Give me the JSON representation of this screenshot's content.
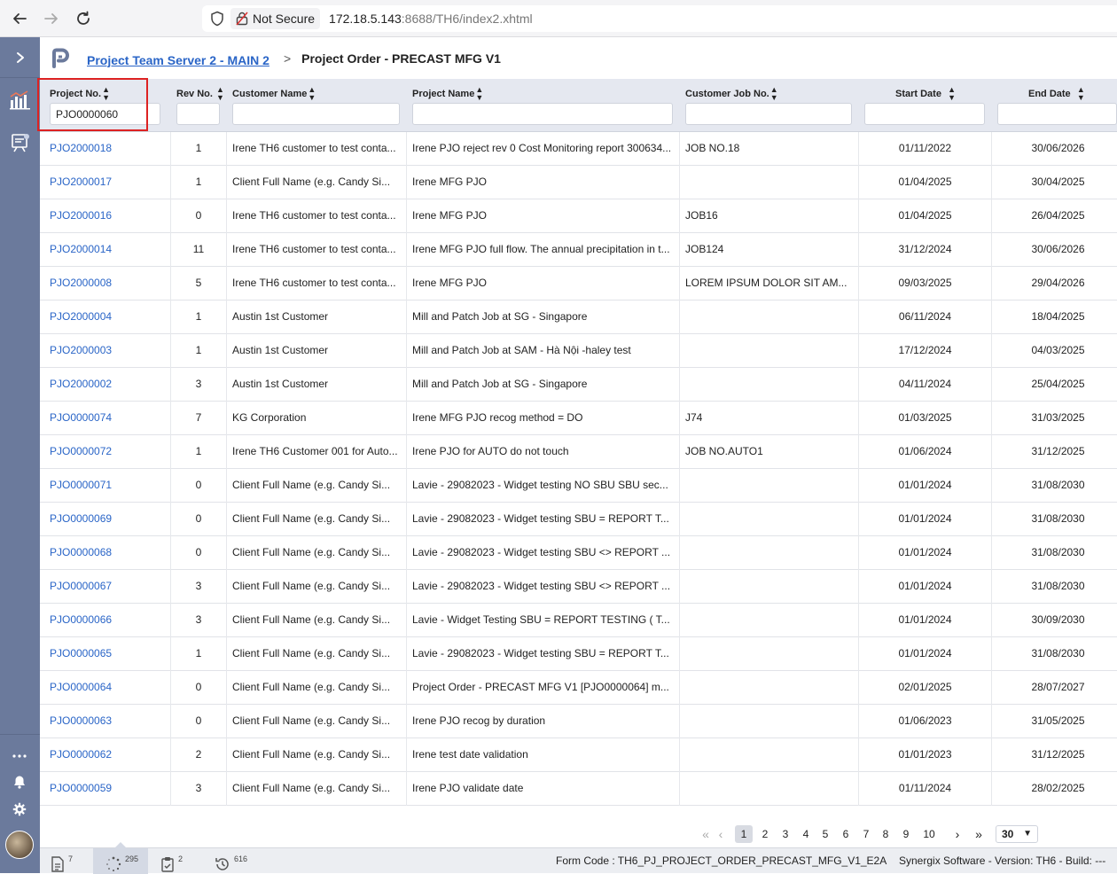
{
  "browser": {
    "security_label": "Not Secure",
    "url_host": "172.18.5.143",
    "url_rest": ":8688/TH6/index2.xhtml"
  },
  "breadcrumb": {
    "parent": "Project Team Server 2 - MAIN 2",
    "separator": ">",
    "current": "Project Order - PRECAST MFG V1"
  },
  "columns": [
    {
      "key": "project_no",
      "label": "Project No."
    },
    {
      "key": "rev_no",
      "label": "Rev No."
    },
    {
      "key": "customer_name",
      "label": "Customer Name"
    },
    {
      "key": "project_name",
      "label": "Project Name"
    },
    {
      "key": "customer_job_no",
      "label": "Customer Job No."
    },
    {
      "key": "start_date",
      "label": "Start Date"
    },
    {
      "key": "end_date",
      "label": "End Date"
    }
  ],
  "filters": {
    "project_no": "PJO0000060",
    "rev_no": "",
    "customer_name": "",
    "project_name": "",
    "customer_job_no": "",
    "start_date": "",
    "end_date": ""
  },
  "rows": [
    {
      "project_no": "PJO2000018",
      "rev_no": "1",
      "customer_name": "Irene TH6 customer to test conta...",
      "project_name": "Irene PJO reject rev 0 Cost Monitoring report 300634...",
      "customer_job_no": "JOB NO.18",
      "start_date": "01/11/2022",
      "end_date": "30/06/2026"
    },
    {
      "project_no": "PJO2000017",
      "rev_no": "1",
      "customer_name": "Client Full Name (e.g. Candy Si...",
      "project_name": "Irene MFG PJO",
      "customer_job_no": "",
      "start_date": "01/04/2025",
      "end_date": "30/04/2025"
    },
    {
      "project_no": "PJO2000016",
      "rev_no": "0",
      "customer_name": "Irene TH6 customer to test conta...",
      "project_name": "Irene MFG PJO",
      "customer_job_no": "JOB16",
      "start_date": "01/04/2025",
      "end_date": "26/04/2025"
    },
    {
      "project_no": "PJO2000014",
      "rev_no": "11",
      "customer_name": "Irene TH6 customer to test conta...",
      "project_name": "Irene MFG PJO full flow. The annual precipitation in t...",
      "customer_job_no": "JOB124",
      "start_date": "31/12/2024",
      "end_date": "30/06/2026"
    },
    {
      "project_no": "PJO2000008",
      "rev_no": "5",
      "customer_name": "Irene TH6 customer to test conta...",
      "project_name": "Irene MFG PJO",
      "customer_job_no": "LOREM IPSUM DOLOR SIT AM...",
      "start_date": "09/03/2025",
      "end_date": "29/04/2026"
    },
    {
      "project_no": "PJO2000004",
      "rev_no": "1",
      "customer_name": "Austin 1st Customer",
      "project_name": "Mill and Patch Job at SG - Singapore",
      "customer_job_no": "",
      "start_date": "06/11/2024",
      "end_date": "18/04/2025"
    },
    {
      "project_no": "PJO2000003",
      "rev_no": "1",
      "customer_name": "Austin 1st Customer",
      "project_name": "Mill and Patch Job at SAM - Hà Nội -haley test",
      "customer_job_no": "",
      "start_date": "17/12/2024",
      "end_date": "04/03/2025"
    },
    {
      "project_no": "PJO2000002",
      "rev_no": "3",
      "customer_name": "Austin 1st Customer",
      "project_name": "Mill and Patch Job at SG - Singapore",
      "customer_job_no": "",
      "start_date": "04/11/2024",
      "end_date": "25/04/2025"
    },
    {
      "project_no": "PJO0000074",
      "rev_no": "7",
      "customer_name": "KG Corporation",
      "project_name": "Irene MFG PJO recog method = DO",
      "customer_job_no": "J74",
      "start_date": "01/03/2025",
      "end_date": "31/03/2025"
    },
    {
      "project_no": "PJO0000072",
      "rev_no": "1",
      "customer_name": "Irene TH6 Customer 001 for Auto...",
      "project_name": "Irene PJO for AUTO do not touch",
      "customer_job_no": "JOB NO.AUTO1",
      "start_date": "01/06/2024",
      "end_date": "31/12/2025"
    },
    {
      "project_no": "PJO0000071",
      "rev_no": "0",
      "customer_name": "Client Full Name (e.g. Candy Si...",
      "project_name": "Lavie - 29082023 - Widget testing NO SBU SBU sec...",
      "customer_job_no": "",
      "start_date": "01/01/2024",
      "end_date": "31/08/2030"
    },
    {
      "project_no": "PJO0000069",
      "rev_no": "0",
      "customer_name": "Client Full Name (e.g. Candy Si...",
      "project_name": "Lavie - 29082023 - Widget testing SBU = REPORT T...",
      "customer_job_no": "",
      "start_date": "01/01/2024",
      "end_date": "31/08/2030"
    },
    {
      "project_no": "PJO0000068",
      "rev_no": "0",
      "customer_name": "Client Full Name (e.g. Candy Si...",
      "project_name": "Lavie - 29082023 - Widget testing SBU <> REPORT ...",
      "customer_job_no": "",
      "start_date": "01/01/2024",
      "end_date": "31/08/2030"
    },
    {
      "project_no": "PJO0000067",
      "rev_no": "3",
      "customer_name": "Client Full Name (e.g. Candy Si...",
      "project_name": "Lavie - 29082023 - Widget testing SBU <> REPORT ...",
      "customer_job_no": "",
      "start_date": "01/01/2024",
      "end_date": "31/08/2030"
    },
    {
      "project_no": "PJO0000066",
      "rev_no": "3",
      "customer_name": "Client Full Name (e.g. Candy Si...",
      "project_name": "Lavie - Widget Testing SBU = REPORT TESTING ( T...",
      "customer_job_no": "",
      "start_date": "01/01/2024",
      "end_date": "30/09/2030"
    },
    {
      "project_no": "PJO0000065",
      "rev_no": "1",
      "customer_name": "Client Full Name (e.g. Candy Si...",
      "project_name": "Lavie - 29082023 - Widget testing SBU = REPORT T...",
      "customer_job_no": "",
      "start_date": "01/01/2024",
      "end_date": "31/08/2030"
    },
    {
      "project_no": "PJO0000064",
      "rev_no": "0",
      "customer_name": "Client Full Name (e.g. Candy Si...",
      "project_name": "Project Order - PRECAST MFG V1 [PJO0000064] m...",
      "customer_job_no": "",
      "start_date": "02/01/2025",
      "end_date": "28/07/2027"
    },
    {
      "project_no": "PJO0000063",
      "rev_no": "0",
      "customer_name": "Client Full Name (e.g. Candy Si...",
      "project_name": "Irene PJO recog by duration",
      "customer_job_no": "",
      "start_date": "01/06/2023",
      "end_date": "31/05/2025"
    },
    {
      "project_no": "PJO0000062",
      "rev_no": "2",
      "customer_name": "Client Full Name (e.g. Candy Si...",
      "project_name": "Irene test date validation",
      "customer_job_no": "",
      "start_date": "01/01/2023",
      "end_date": "31/12/2025"
    },
    {
      "project_no": "PJO0000059",
      "rev_no": "3",
      "customer_name": "Client Full Name (e.g. Candy Si...",
      "project_name": "Irene PJO validate date",
      "customer_job_no": "",
      "start_date": "01/11/2024",
      "end_date": "28/02/2025"
    }
  ],
  "pagination": {
    "pages": [
      "1",
      "2",
      "3",
      "4",
      "5",
      "6",
      "7",
      "8",
      "9",
      "10"
    ],
    "current_page": "1",
    "page_size": "30"
  },
  "statusbar": {
    "docs_count": "7",
    "pending_count": "295",
    "tasks_count": "2",
    "history_count": "616",
    "form_code": "Form Code : TH6_PJ_PROJECT_ORDER_PRECAST_MFG_V1_E2A",
    "version": "Synergix Software - Version: TH6 - Build: ---"
  },
  "icons": {
    "back": "back-arrow-icon",
    "forward": "forward-arrow-icon",
    "reload": "reload-icon",
    "shield": "shield-icon",
    "lock": "insecure-lock-icon",
    "expand": "chevron-right-icon",
    "dashboard": "dashboard-chart-icon",
    "reports": "reports-icon",
    "more": "more-dots-icon",
    "bell": "bell-icon",
    "gear": "gear-icon"
  },
  "colors": {
    "sidebar": "#6b7a9c",
    "link": "#2a65c7",
    "header_bg": "#e5e8f0",
    "highlight": "#dd2222"
  }
}
